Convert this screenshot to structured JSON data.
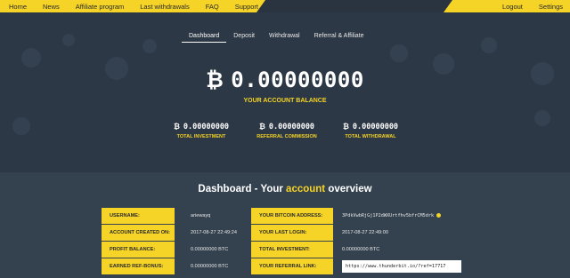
{
  "nav": {
    "left": [
      "Home",
      "News",
      "Affiliate program",
      "Last withdrawals",
      "FAQ",
      "Support"
    ],
    "right": [
      "Logout",
      "Settings"
    ]
  },
  "tabs": [
    "Dashboard",
    "Deposit",
    "Withdrawal",
    "Referral & Affiliate"
  ],
  "balance": {
    "symbol": "₿",
    "value": "0.00000000",
    "label": "YOUR ACCOUNT BALANCE"
  },
  "stats": [
    {
      "symbol": "₿",
      "value": "0.00000000",
      "label": "TOTAL INVESTMENT"
    },
    {
      "symbol": "₿",
      "value": "0.00000000",
      "label": "REFERRAL COMMISSION"
    },
    {
      "symbol": "₿",
      "value": "0.00000000",
      "label": "TOTAL WITHDRAWAL"
    }
  ],
  "overview": {
    "title_prefix": "Dashboard - Your ",
    "title_highlight": "account",
    "title_suffix": " overview"
  },
  "rows": [
    {
      "label_l": "USERNAME:",
      "value_l": "ariewayq",
      "label_r": "YOUR BITCOIN ADDRESS:",
      "value_r": "3PdkVwbRjGj1P2dWXUrtfhv5bfrCM5drk"
    },
    {
      "label_l": "ACCOUNT CREATED ON:",
      "value_l": "2017-08-27 22:49:24",
      "label_r": "YOUR LAST LOGIN:",
      "value_r": "2017-08-27 22:49:00"
    },
    {
      "label_l": "PROFIT BALANCE:",
      "value_l": "0.00000000 BTC",
      "label_r": "TOTAL INVESTMENT:",
      "value_r": "0.00000000 BTC"
    },
    {
      "label_l": "EARNED REF-BONUS:",
      "value_l": "0.00000000 BTC",
      "label_r": "YOUR REFERRAL LINK:",
      "value_r": "https://www.thunderbit.io/?ref=17717"
    }
  ],
  "colors": {
    "accent": "#f5d327",
    "background": "#2f3b49"
  }
}
